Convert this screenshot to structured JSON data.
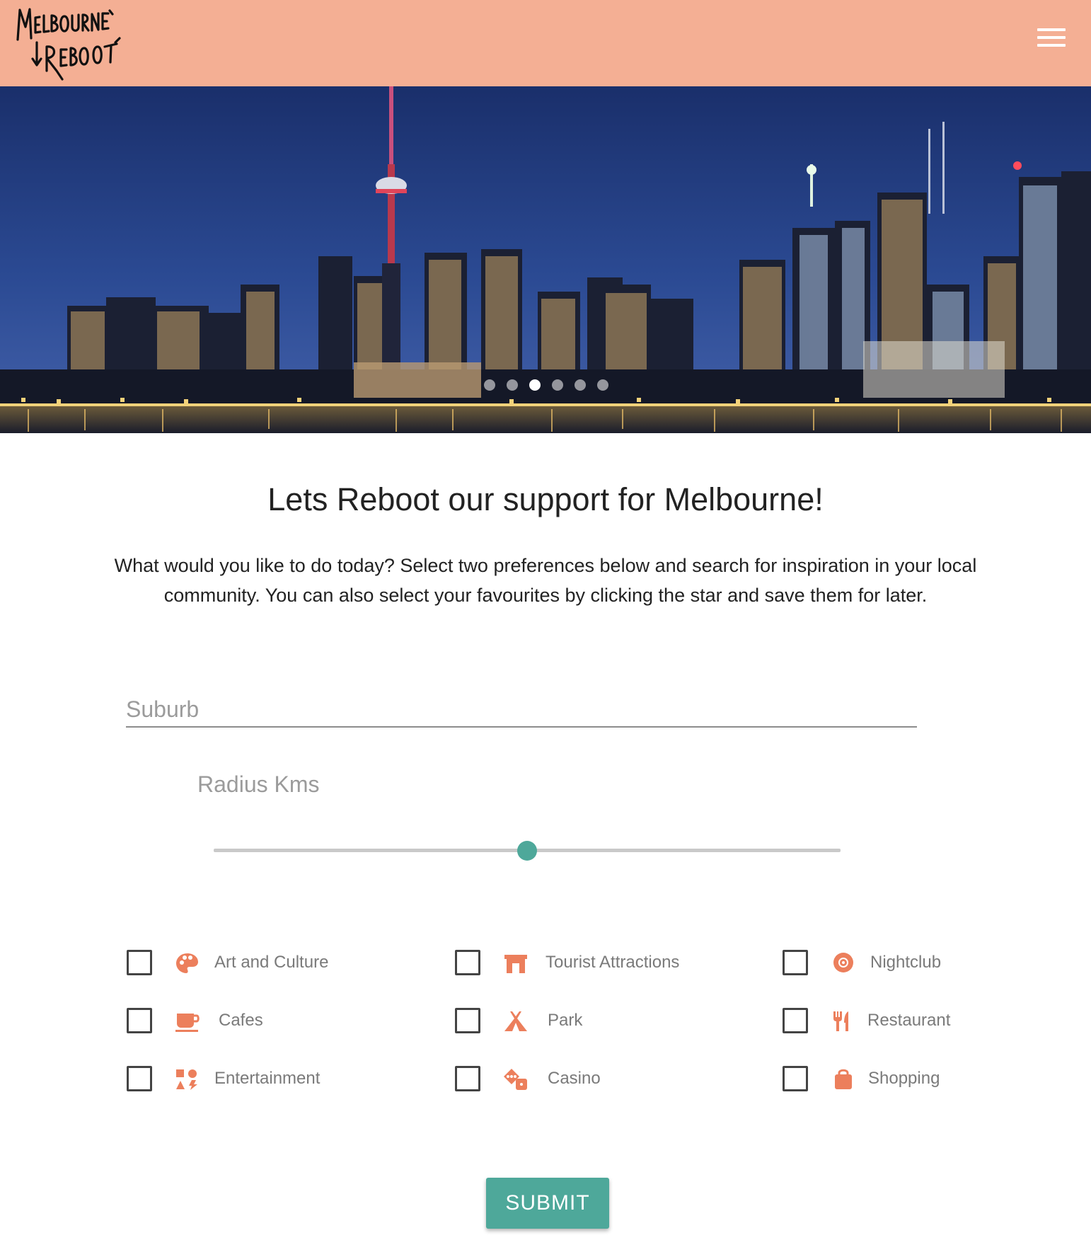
{
  "header": {
    "logo_text": "Melbourne Reboot",
    "background": "#f4af94",
    "menu_icon": "hamburger-menu-icon"
  },
  "hero": {
    "slide_count": 6,
    "active_slide": 3
  },
  "main": {
    "title": "Lets Reboot our support for Melbourne!",
    "intro": "What would you like to do today? Select two preferences below and search for inspiration in your local community. You can also select your favourites by clicking the star and save them for later."
  },
  "search": {
    "suburb_placeholder": "Suburb",
    "suburb_value": ""
  },
  "radius": {
    "label": "Radius Kms",
    "value_fraction": 0.5
  },
  "preferences": [
    {
      "label": "Art and Culture",
      "icon": "palette-icon",
      "checked": false
    },
    {
      "label": "Tourist Attractions",
      "icon": "landmark-gate-icon",
      "checked": false
    },
    {
      "label": "Nightclub",
      "icon": "record-disc-icon",
      "checked": false
    },
    {
      "label": "Cafes",
      "icon": "coffee-cup-icon",
      "checked": false
    },
    {
      "label": "Park",
      "icon": "tent-icon",
      "checked": false
    },
    {
      "label": "Restaurant",
      "icon": "utensils-icon",
      "checked": false
    },
    {
      "label": "Entertainment",
      "icon": "shapes-icon",
      "checked": false
    },
    {
      "label": "Casino",
      "icon": "dice-icon",
      "checked": false
    },
    {
      "label": "Shopping",
      "icon": "shopping-bag-icon",
      "checked": false
    }
  ],
  "submit": {
    "label": "SUBMIT"
  },
  "colors": {
    "accent": "#4ea89a",
    "icon": "#ec7f5c",
    "header": "#f4af94"
  }
}
